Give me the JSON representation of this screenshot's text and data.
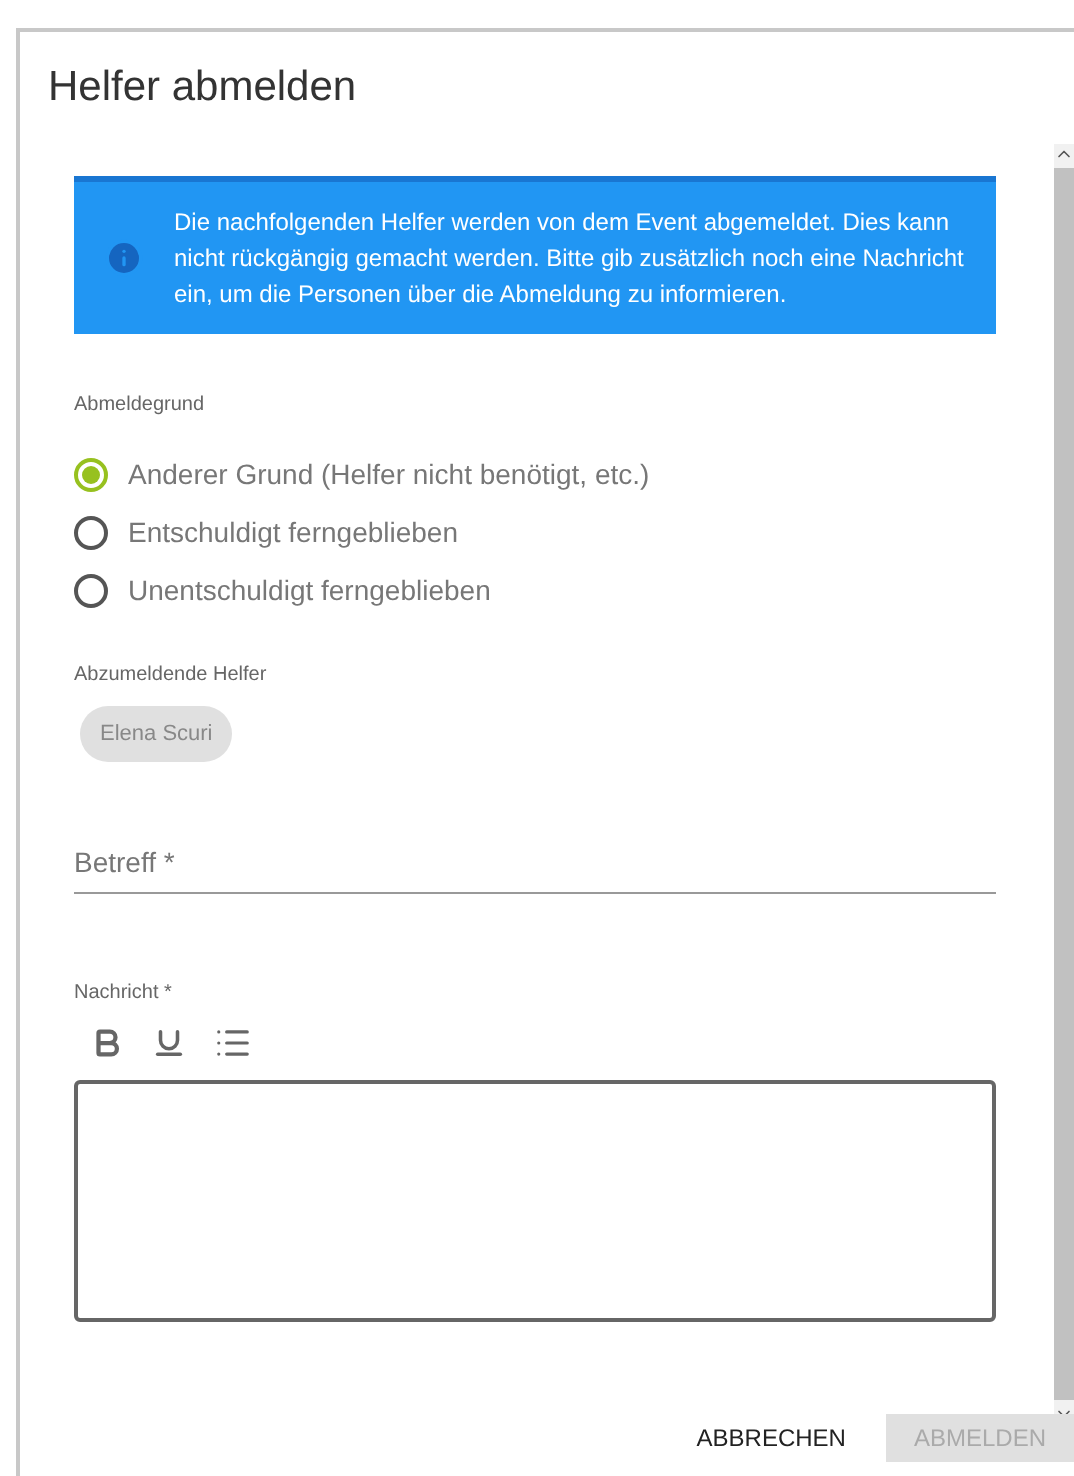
{
  "dialog": {
    "title": "Helfer abmelden"
  },
  "alert": {
    "text": "Die nachfolgenden Helfer werden von dem Event abgemeldet. Dies kann nicht rückgängig gemacht werden. Bitte gib zusätzlich noch eine Nachricht ein, um die Personen über die Abmeldung zu informieren."
  },
  "reason": {
    "label": "Abmeldegrund",
    "options": [
      {
        "label": "Anderer Grund (Helfer nicht benötigt, etc.)",
        "selected": true
      },
      {
        "label": "Entschuldigt ferngeblieben",
        "selected": false
      },
      {
        "label": "Unentschuldigt ferngeblieben",
        "selected": false
      }
    ]
  },
  "helpers": {
    "label": "Abzumeldende Helfer",
    "chips": [
      "Elena Scuri"
    ]
  },
  "subject": {
    "placeholder": "Betreff *"
  },
  "message": {
    "label": "Nachricht *"
  },
  "buttons": [
    {
      "label": "ABBRECHEN",
      "disabled": false
    },
    {
      "label": "ABMELDEN",
      "disabled": true
    }
  ]
}
